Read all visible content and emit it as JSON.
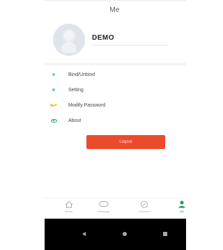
{
  "header": {
    "title": "Me"
  },
  "profile": {
    "name": "DEMO"
  },
  "menu": {
    "items": [
      {
        "label": "Bind/Unbind",
        "icon": "bind-dot-icon",
        "color": "#7fd2a9"
      },
      {
        "label": "Setting",
        "icon": "setting-dot-icon",
        "color": "#61c7e6"
      },
      {
        "label": "Modify Password",
        "icon": "key-icon",
        "color": "#f0c64a"
      },
      {
        "label": "About",
        "icon": "eye-icon",
        "color": "#2e9e6a"
      }
    ]
  },
  "logout": {
    "label": "Logout",
    "color": "#ec4a2c"
  },
  "tabbar": {
    "tabs": [
      {
        "label": "Home",
        "icon": "home-icon"
      },
      {
        "label": "Message",
        "icon": "message-icon"
      },
      {
        "label": "Discover",
        "icon": "compass-icon"
      },
      {
        "label": "Me",
        "icon": "person-icon",
        "active": true,
        "color": "#1a9a5a"
      }
    ]
  }
}
